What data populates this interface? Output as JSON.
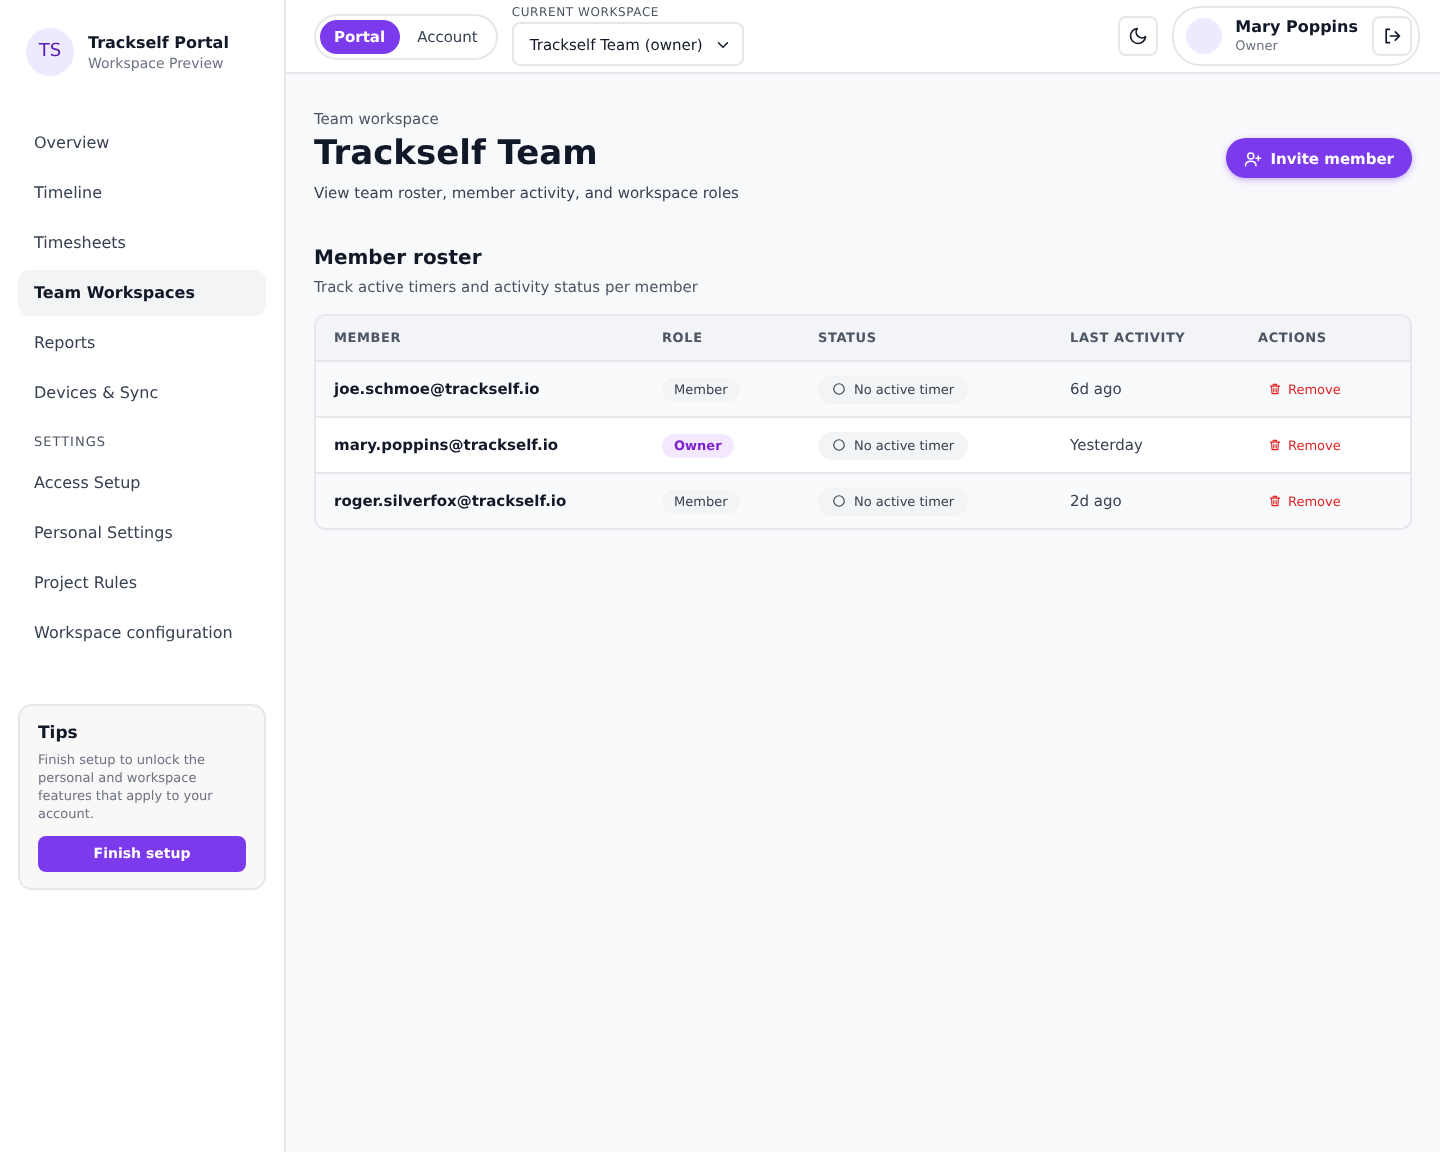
{
  "brand": {
    "initials": "TS",
    "title": "Trackself Portal",
    "subtitle": "Workspace Preview"
  },
  "sidebar": {
    "items": [
      {
        "label": "Overview",
        "selected": false
      },
      {
        "label": "Timeline",
        "selected": false
      },
      {
        "label": "Timesheets",
        "selected": false
      },
      {
        "label": "Team Workspaces",
        "selected": true
      },
      {
        "label": "Reports",
        "selected": false
      },
      {
        "label": "Devices & Sync",
        "selected": false
      }
    ],
    "settings_heading": "SETTINGS",
    "settings_items": [
      {
        "label": "Access Setup",
        "selected": false
      },
      {
        "label": "Personal Settings",
        "selected": false
      },
      {
        "label": "Project Rules",
        "selected": false
      },
      {
        "label": "Workspace configuration",
        "selected": false
      }
    ],
    "tips": {
      "title": "Tips",
      "text": "Finish setup to unlock the personal and workspace features that apply to your account.",
      "button": "Finish setup"
    }
  },
  "topbar": {
    "modes": [
      {
        "label": "Portal",
        "selected": true
      },
      {
        "label": "Account",
        "selected": false
      }
    ],
    "workspace_label": "CURRENT WORKSPACE",
    "workspace_value": "Trackself Team (owner)",
    "user": {
      "name": "Mary Poppins",
      "role": "Owner"
    }
  },
  "page": {
    "eyebrow": "Team workspace",
    "title": "Trackself Team",
    "subtitle": "View team roster, member activity, and workspace roles",
    "invite_button": "Invite member"
  },
  "roster": {
    "title": "Member roster",
    "subtitle": "Track active timers and activity status per member",
    "columns": [
      "MEMBER",
      "ROLE",
      "STATUS",
      "LAST ACTIVITY",
      "ACTIONS"
    ],
    "rows": [
      {
        "member": "joe.schmoe@trackself.io",
        "role": {
          "label": "Member",
          "kind": "member"
        },
        "status": "No active timer",
        "last_activity": "6d ago",
        "action": "Remove"
      },
      {
        "member": "mary.poppins@trackself.io",
        "role": {
          "label": "Owner",
          "kind": "owner"
        },
        "status": "No active timer",
        "last_activity": "Yesterday",
        "action": "Remove"
      },
      {
        "member": "roger.silverfox@trackself.io",
        "role": {
          "label": "Member",
          "kind": "member"
        },
        "status": "No active timer",
        "last_activity": "2d ago",
        "action": "Remove"
      }
    ]
  }
}
